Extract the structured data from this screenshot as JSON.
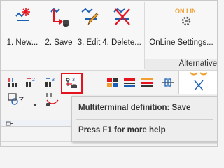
{
  "ribbon": {
    "buttons": [
      {
        "label": "1. New...",
        "icon": "new-star-icon"
      },
      {
        "label": "2. Save",
        "icon": "save-arrow-icon"
      },
      {
        "label": "3. Edit",
        "icon": "edit-icon"
      },
      {
        "label": "4. Delete...",
        "icon": "delete-x-icon"
      },
      {
        "label": "OnLine Settings...",
        "icon": "online-gear-icon"
      }
    ],
    "online_badge_text": "ON LINE",
    "group_label": "Alternative"
  },
  "tooltip": {
    "title": "Multiterminal definition: Save",
    "help": "Press F1 for more help"
  },
  "colors": {
    "accent_red": "#e4131e",
    "icon_blue": "#1a5fb4",
    "icon_orange": "#f0a030"
  }
}
